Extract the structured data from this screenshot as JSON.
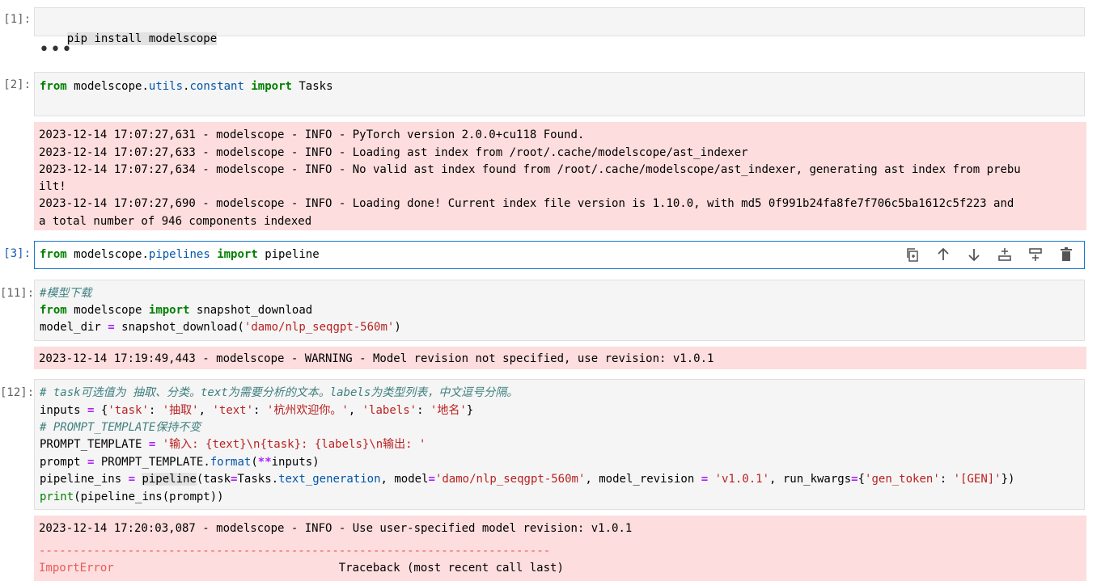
{
  "cells": [
    {
      "prompt": "[1]:",
      "lines": [
        "pip install modelscope"
      ]
    },
    {
      "prompt": "[2]:",
      "lines": [
        "from modelscope.utils.constant import Tasks"
      ]
    },
    {
      "prompt": "[3]:"
    },
    {
      "prompt": "[11]:"
    },
    {
      "prompt": "[12]:"
    }
  ],
  "collapsed_output": "•••",
  "cell3_toolbar": {
    "icons": [
      "duplicate-icon",
      "move-up-icon",
      "move-down-icon",
      "insert-below-icon",
      "insert-above-icon",
      "delete-icon"
    ]
  },
  "outputs": {
    "out2": [
      "2023-12-14 17:07:27,631 - modelscope - INFO - PyTorch version 2.0.0+cu118 Found.",
      "2023-12-14 17:07:27,633 - modelscope - INFO - Loading ast index from /root/.cache/modelscope/ast_indexer",
      "2023-12-14 17:07:27,634 - modelscope - INFO - No valid ast index found from /root/.cache/modelscope/ast_indexer, generating ast index from prebu",
      "ilt!",
      "2023-12-14 17:07:27,690 - modelscope - INFO - Loading done! Current index file version is 1.10.0, with md5 0f991b24fa8fe7f706c5ba1612c5f223 and",
      "a total number of 946 components indexed"
    ],
    "out11": "2023-12-14 17:19:49,443 - modelscope - WARNING - Model revision not specified, use revision: v1.0.1",
    "out12_info": "2023-12-14 17:20:03,087 - modelscope - INFO - Use user-specified model revision: v1.0.1",
    "out12_dashes": "---------------------------------------------------------------------------",
    "out12_error_name": "ImportError",
    "out12_traceback": "Traceback (most recent call last)"
  },
  "code": {
    "c2_from": "from",
    "c2_mod": "modelscope",
    "c2_dot": ".",
    "c2_sub1": "utils",
    "c2_sub2": "constant",
    "c2_import": "import",
    "c2_name": "Tasks",
    "c3_from": "from",
    "c3_mod": "modelscope",
    "c3_sub": "pipelines",
    "c3_import": "import",
    "c3_name": "pipeline",
    "c11_comment": "#模型下载",
    "c11_from": "from",
    "c11_mod": "modelscope",
    "c11_import": "import",
    "c11_name": "snapshot_download",
    "c11_l3a": "model_dir ",
    "c11_eq": "=",
    "c11_l3b": " snapshot_download(",
    "c11_str": "'damo/nlp_seqgpt-560m'",
    "c11_l3c": ")",
    "c12_comment1": "# task可选值为 抽取、分类。text为需要分析的文本。labels为类型列表，中文逗号分隔。",
    "c12_l2a": "inputs ",
    "c12_eq": "=",
    "c12_l2b": " {",
    "c12_s1": "'task'",
    "c12_colon1": ": ",
    "c12_s2": "'抽取'",
    "c12_comma1": ", ",
    "c12_s3": "'text'",
    "c12_colon2": ": ",
    "c12_s4": "'杭州欢迎你。'",
    "c12_comma2": ", ",
    "c12_s5": "'labels'",
    "c12_colon3": ": ",
    "c12_s6": "'地名'",
    "c12_l2end": "}",
    "c12_comment2": "# PROMPT_TEMPLATE保持不变",
    "c12_l4a": "PROMPT_TEMPLATE ",
    "c12_l4b": " ",
    "c12_l4str": "'输入: {text}\\n{task}: {labels}\\n输出: '",
    "c12_l5a": "prompt ",
    "c12_l5b": " PROMPT_TEMPLATE.",
    "c12_l5fmt": "format",
    "c12_l5c": "(",
    "c12_l5op": "**",
    "c12_l5d": "inputs)",
    "c12_l6a": "pipeline_ins ",
    "c12_l6b": " ",
    "c12_l6pl": "pipeline",
    "c12_l6c": "(task",
    "c12_l6d": "Tasks.",
    "c12_l6tg": "text_generation",
    "c12_l6e": ", model",
    "c12_l6s1": "'damo/nlp_seqgpt-560m'",
    "c12_l6f": ", model_revision ",
    "c12_l6g": " ",
    "c12_l6s2": "'v1.0.1'",
    "c12_l6h": ", run_kwargs",
    "c12_l6i": "{",
    "c12_l6s3": "'gen_token'",
    "c12_l6j": ": ",
    "c12_l6s4": "'[GEN]'",
    "c12_l6k": "})",
    "c12_l7print": "print",
    "c12_l7rest": "(pipeline_ins(prompt))"
  }
}
